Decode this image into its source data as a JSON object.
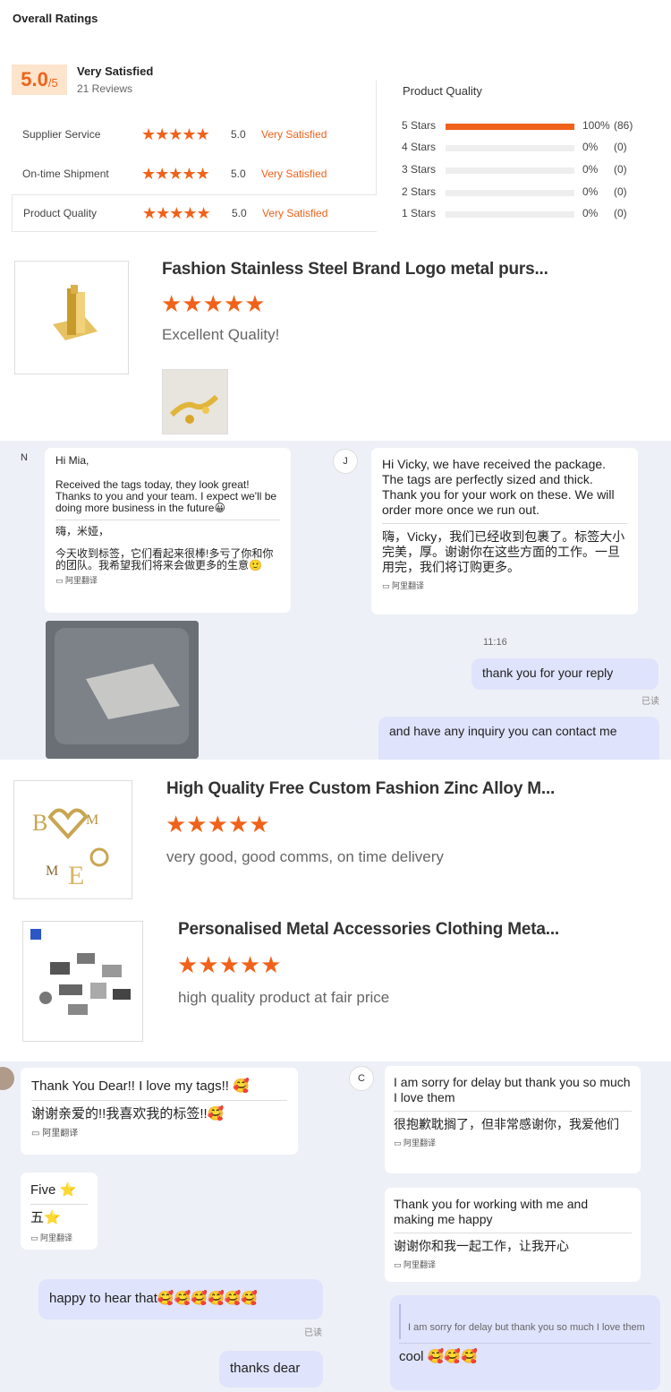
{
  "header": {
    "title": "Overall Ratings",
    "score": "5.0",
    "score_out_of": "/5",
    "summary_label": "Very Satisfied",
    "reviews": "21 Reviews"
  },
  "rating_rows": [
    {
      "name": "Supplier Service",
      "score": "5.0",
      "label": "Very Satisfied"
    },
    {
      "name": "On-time Shipment",
      "score": "5.0",
      "label": "Very Satisfied"
    },
    {
      "name": "Product Quality",
      "score": "5.0",
      "label": "Very Satisfied"
    }
  ],
  "distribution": {
    "title": "Product Quality",
    "rows": [
      {
        "stars": "5 Stars",
        "percent": "100%",
        "count": "(86)",
        "fill": 1.0
      },
      {
        "stars": "4 Stars",
        "percent": "0%",
        "count": "(0)",
        "fill": 0
      },
      {
        "stars": "3 Stars",
        "percent": "0%",
        "count": "(0)",
        "fill": 0
      },
      {
        "stars": "2 Stars",
        "percent": "0%",
        "count": "(0)",
        "fill": 0
      },
      {
        "stars": "1 Stars",
        "percent": "0%",
        "count": "(0)",
        "fill": 0
      }
    ]
  },
  "stars": "★★★★★",
  "reviews": [
    {
      "title": "Fashion Stainless Steel Brand Logo metal purs...",
      "comment": "Excellent Quality!"
    },
    {
      "title": "High Quality Free Custom Fashion Zinc Alloy M...",
      "comment": "very good, good comms, on time delivery"
    },
    {
      "title": "Personalised Metal Accessories Clothing Meta...",
      "comment": "high quality product at fair price"
    }
  ],
  "chat1": {
    "avatar_n": "N",
    "avatar_j": "J",
    "n_greet": "Hi Mia,",
    "n_en": "Received the tags today, they look great! Thanks to you and your team. I expect we'll be doing more business in the future😀",
    "n_zh1": "嗨，米娅，",
    "n_zh2": "今天收到标签，它们看起来很棒!多亏了你和你的团队。我希望我们将来会做更多的生意🙂",
    "translate": "阿里翻译",
    "j_en": "Hi Vicky, we have received the package. The tags are perfectly sized and thick. Thank you for your work on these. We will order more once we run out.",
    "j_zh": "嗨，Vicky，我们已经收到包裹了。标签大小完美，厚。谢谢你在这些方面的工作。一旦用完，我们将订购更多。",
    "time": "11:16",
    "me1": "thank you for your reply",
    "read": "已读",
    "me2": "and have any inquiry you can contact me"
  },
  "chat2": {
    "avatar_c": "C",
    "b1_en": "Thank You Dear!! I love my tags!! 🥰",
    "b1_zh": "谢谢亲爱的!!我喜欢我的标签!!🥰",
    "translate": "阿里翻译",
    "c1_en": "I am sorry for delay but thank you so much I love them",
    "c1_zh": "很抱歉耽搁了，但非常感谢你，我爱他们",
    "b2_en": "Five ⭐",
    "b2_zh": "五⭐",
    "c2_en": "Thank you for working with me and making me happy",
    "c2_zh": "谢谢你和我一起工作，让我开心",
    "me1": "happy to hear that🥰🥰🥰🥰🥰🥰",
    "read": "已读",
    "me2": "thanks dear",
    "quote": "I am sorry for delay but thank you so much I love them",
    "cool": "cool 🥰🥰🥰"
  }
}
